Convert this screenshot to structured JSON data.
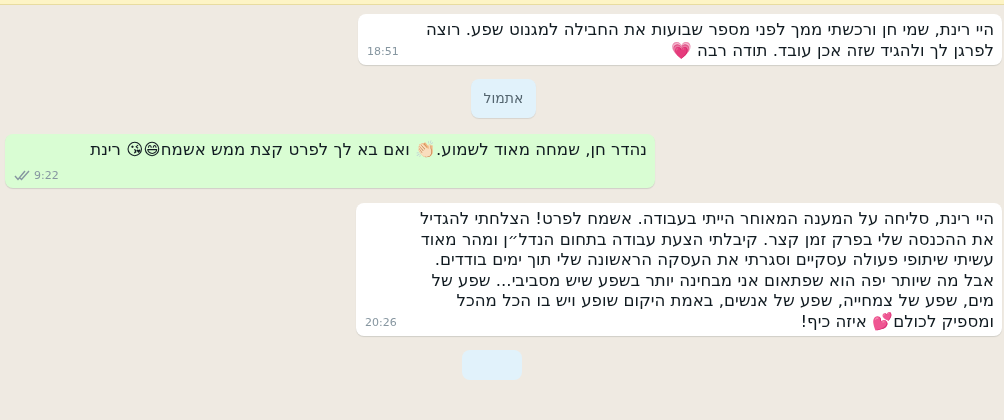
{
  "messages": [
    {
      "kind": "message",
      "outgoing": false,
      "text": "היי רינת, שמי חן ורכשתי ממך לפני מספר שבועות את החבילה למגנוט שפע. רוצה לפרגן לך ולהגיד שזה אכן עובד. תודה רבה 💗",
      "time": "18:51"
    },
    {
      "kind": "date",
      "text": "אתמול"
    },
    {
      "kind": "message",
      "outgoing": true,
      "text": "נהדר חן, שמחה מאוד לשמוע.👏🏻 ואם בא לך לפרט קצת ממש אשמח😄😘 רינת",
      "time": "9:22",
      "read": false
    },
    {
      "kind": "message",
      "outgoing": false,
      "text": "היי רינת, סליחה על המענה המאוחר הייתי בעבודה. אשמח לפרט! הצלחתי להגדיל את ההכנסה שלי בפרק זמן קצר. קיבלתי הצעת עבודה בתחום הנדל״ן ומהר מאוד עשיתי שיתופי פעולה עסקיים וסגרתי את העסקה הראשונה שלי תוך ימים בודדים. אבל מה שיותר יפה הוא שפתאום אני מבחינה יותר בשפע שיש מסביבי... שפע של מים, שפע של צמחייה, שפע של אנשים, באמת היקום שופע ויש בו הכל מהכל ומספיק לכולם💕 איזה כיף!",
      "time": "20:26"
    }
  ]
}
